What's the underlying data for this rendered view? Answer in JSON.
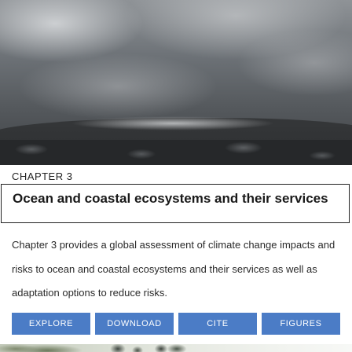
{
  "hero_image": {
    "description_icon": "landscape-photo"
  },
  "chapter": {
    "label": "CHAPTER 3",
    "title": "Ocean and coastal ecosystems and their services",
    "summary": "Chapter 3 provides a global assessment of climate change impacts and risks to ocean and coastal ecosystems and their services as well as adaptation options to reduce risks."
  },
  "actions": {
    "explore": "EXPLORE",
    "download": "DOWNLOAD",
    "cite": "CITE",
    "figures": "FIGURES"
  },
  "colors": {
    "button_bg": "#4b7cc6",
    "button_text": "#ffffff",
    "title_border": "#222222"
  }
}
